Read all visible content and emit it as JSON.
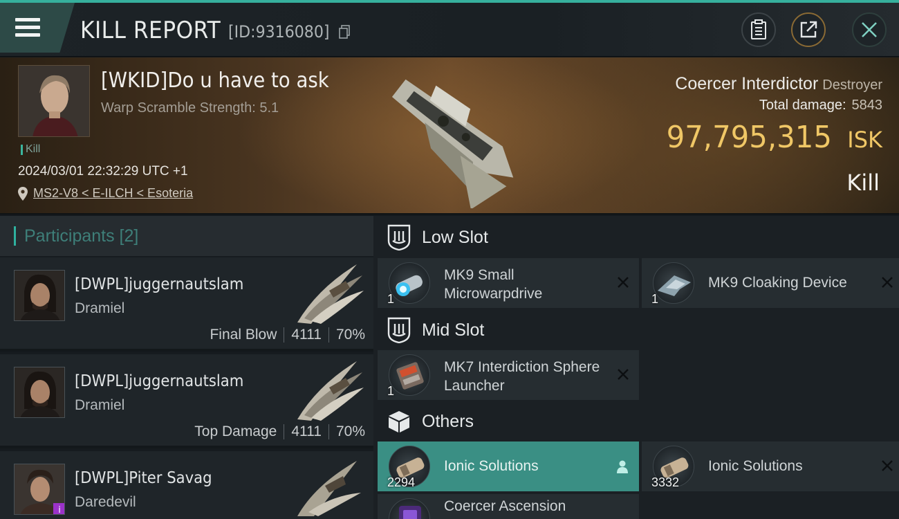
{
  "header": {
    "title": "KILL REPORT",
    "report_id": "[ID:9316080]"
  },
  "victim": {
    "name": "[WKID]Do u have to ask",
    "subtitle": "Warp Scramble Strength: 5.1",
    "tag": "Kill",
    "time": "2024/03/01 22:32:29 UTC +1",
    "location": "MS2-V8 < E-ILCH < Esoteria",
    "ship": "Coercer Interdictor",
    "ship_class": "Destroyer",
    "total_damage_label": "Total damage:",
    "total_damage": "5843",
    "isk_value": "97,795,315",
    "isk_unit": "ISK",
    "result": "Kill"
  },
  "participants": {
    "title": "Participants [2]",
    "rows": [
      {
        "name": "[DWPL]juggernautslam",
        "ship": "Dramiel",
        "role": "Final Blow",
        "damage": "4111",
        "percent": "70%"
      },
      {
        "name": "[DWPL]juggernautslam",
        "ship": "Dramiel",
        "role": "Top Damage",
        "damage": "4111",
        "percent": "70%"
      },
      {
        "name": "[DWPL]Piter Savag",
        "ship": "Daredevil"
      }
    ]
  },
  "fitting": {
    "low_slot": {
      "label": "Low Slot",
      "items": [
        {
          "name": "MK9 Small Microwarpdrive",
          "qty": "1"
        },
        {
          "name": "MK9 Cloaking Device",
          "qty": "1"
        }
      ]
    },
    "mid_slot": {
      "label": "Mid Slot",
      "items": [
        {
          "name": "MK7 Interdiction Sphere Launcher",
          "qty": "1"
        }
      ]
    },
    "others": {
      "label": "Others",
      "items": [
        {
          "name": "Ionic Solutions",
          "qty": "2294"
        },
        {
          "name": "Ionic Solutions",
          "qty": "3332"
        },
        {
          "name": "Coercer Ascension"
        }
      ]
    }
  },
  "colors": {
    "accent": "#36b09d",
    "isk": "#f0c766",
    "highlight_row": "#3a8f84"
  }
}
